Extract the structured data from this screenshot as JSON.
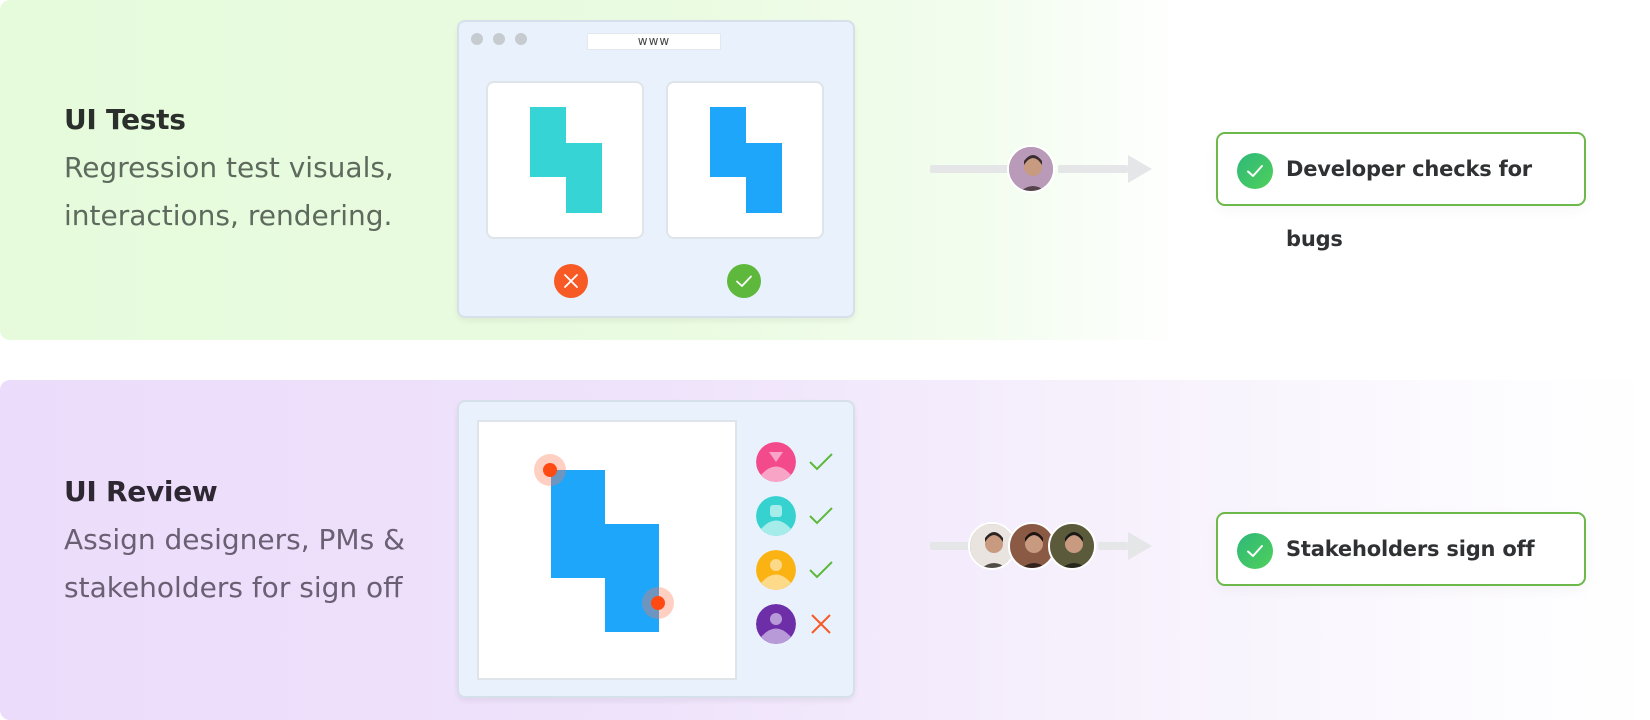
{
  "sections": {
    "tests": {
      "title": "UI Tests",
      "description_line1": "Regression test visuals,",
      "description_line2": "interactions, rendering.",
      "browser": {
        "url": "www",
        "panels": [
          {
            "shape_color": "#36d4d4",
            "status": "fail",
            "status_icon": "close-icon",
            "status_color": "#f75a25"
          },
          {
            "shape_color": "#1ea6fb",
            "status": "pass",
            "status_icon": "check-icon",
            "status_color": "#5db83b"
          }
        ]
      },
      "flow": {
        "avatars": [
          {
            "name": "developer-avatar",
            "colors": [
              "#b99ab8",
              "#3a2d31"
            ]
          }
        ]
      },
      "result": {
        "label": "Developer checks for bugs",
        "icon": "check-circle-icon"
      }
    },
    "review": {
      "title": "UI Review",
      "description_line1": "Assign designers, PMs &",
      "description_line2": "stakeholders for sign off",
      "canvas": {
        "shape_color": "#1ea6fb",
        "pin_color": "#ff4a12",
        "comment_pins": 2
      },
      "reviewers": [
        {
          "name": "reviewer-pink",
          "color": "#f24a8b",
          "light": "#f8a4c6",
          "verdict": "approved"
        },
        {
          "name": "reviewer-teal",
          "color": "#36d2d0",
          "light": "#a6ecea",
          "verdict": "approved"
        },
        {
          "name": "reviewer-yellow",
          "color": "#fbb314",
          "light": "#fdd98a",
          "verdict": "approved"
        },
        {
          "name": "reviewer-purple",
          "color": "#6e2ea8",
          "light": "#b99ad9",
          "verdict": "rejected"
        }
      ],
      "flow": {
        "avatars": [
          {
            "name": "stakeholder-avatar-1",
            "colors": [
              "#e9e4df",
              "#2a2422"
            ]
          },
          {
            "name": "stakeholder-avatar-2",
            "colors": [
              "#8a5a44",
              "#1e1512"
            ]
          },
          {
            "name": "stakeholder-avatar-3",
            "colors": [
              "#5b5a3a",
              "#1a1a18"
            ]
          }
        ]
      },
      "result": {
        "label": "Stakeholders sign off",
        "icon": "check-circle-icon"
      }
    }
  },
  "colors": {
    "accent_green": "#6cb84a",
    "check_green": "#3ec46a",
    "approve_green": "#5db83b",
    "reject_orange": "#f75a25"
  }
}
